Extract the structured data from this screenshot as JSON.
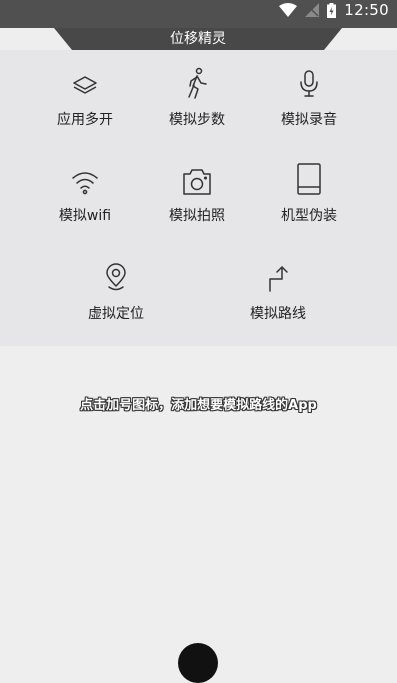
{
  "status": {
    "time": "12:50"
  },
  "header": {
    "title": "位移精灵"
  },
  "features": [
    {
      "label": "应用多开",
      "icon": "layers-icon"
    },
    {
      "label": "模拟步数",
      "icon": "walking-icon"
    },
    {
      "label": "模拟录音",
      "icon": "microphone-icon"
    },
    {
      "label": "模拟wifi",
      "icon": "wifi-icon"
    },
    {
      "label": "模拟拍照",
      "icon": "camera-icon"
    },
    {
      "label": "机型伪装",
      "icon": "phone-icon"
    },
    {
      "label": "虚拟定位",
      "icon": "location-pin-icon"
    },
    {
      "label": "模拟路线",
      "icon": "route-arrow-icon"
    }
  ],
  "hint": "点击加号图标，添加想要模拟路线的App",
  "colors": {
    "status_bar": "#505050",
    "header_tab": "#484848",
    "panel": "#e6e6e8",
    "background": "#efeeef"
  }
}
